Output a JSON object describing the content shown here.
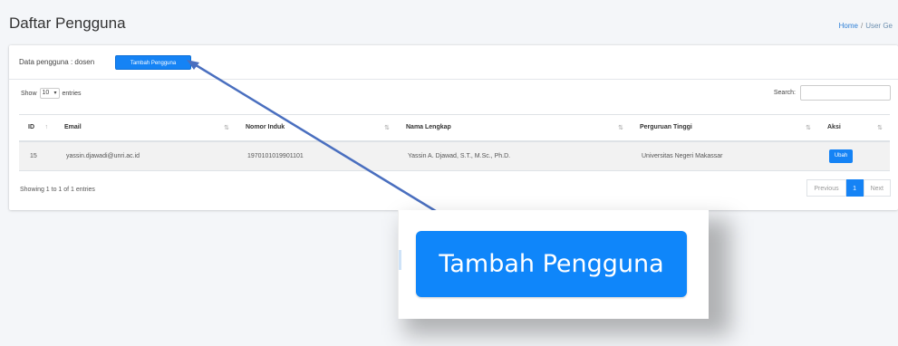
{
  "page": {
    "title": "Daftar Pengguna",
    "breadcrumb": {
      "home": "Home",
      "separator": "/",
      "current": "User Ge"
    }
  },
  "card": {
    "header_text": "Data pengguna : dosen",
    "add_button_label": "Tambah Pengguna"
  },
  "table_controls": {
    "show_label": "Show",
    "entries_value": "10",
    "entries_label": "entries",
    "search_label": "Search:"
  },
  "table": {
    "columns": [
      "ID",
      "Email",
      "Nomor Induk",
      "Nama Lengkap",
      "Perguruan Tinggi",
      "Aksi"
    ],
    "rows": [
      {
        "id": "15",
        "email": "yassin.djawadi@unri.ac.id",
        "nomor_induk": "1970101019901101",
        "nama_lengkap": "Yassin A. Djawad, S.T., M.Sc., Ph.D.",
        "perguruan_tinggi": "Universitas Negeri Makassar",
        "action_label": "Ubah"
      }
    ]
  },
  "footer": {
    "info": "Showing 1 to 1 of 1 entries",
    "pagination": {
      "previous": "Previous",
      "current_page": "1",
      "next": "Next"
    }
  },
  "callout": {
    "zoomed_button_label": "Tambah Pengguna"
  },
  "colors": {
    "primary": "#1583f5",
    "arrow": "#4a6fbf"
  }
}
